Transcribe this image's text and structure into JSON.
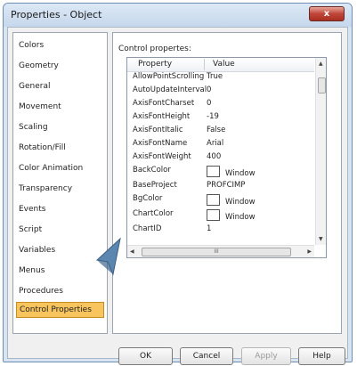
{
  "window": {
    "title": "Properties - Object",
    "close_glyph": "x"
  },
  "sidebar": {
    "items": [
      {
        "label": "Colors"
      },
      {
        "label": "Geometry"
      },
      {
        "label": "General"
      },
      {
        "label": "Movement"
      },
      {
        "label": "Scaling"
      },
      {
        "label": "Rotation/Fill"
      },
      {
        "label": "Color Animation"
      },
      {
        "label": "Transparency"
      },
      {
        "label": "Events"
      },
      {
        "label": "Script"
      },
      {
        "label": "Variables"
      },
      {
        "label": "Menus"
      },
      {
        "label": "Procedures"
      },
      {
        "label": "Control Properties",
        "selected": true
      }
    ]
  },
  "main": {
    "section_label": "Control propertes:",
    "columns": {
      "property": "Property",
      "value": "Value"
    },
    "rows": [
      {
        "property": "AllowPointScrolling",
        "value": "True"
      },
      {
        "property": "AutoUpdateInterval",
        "value": "0"
      },
      {
        "property": "AxisFontCharset",
        "value": "0"
      },
      {
        "property": "AxisFontHeight",
        "value": "-19"
      },
      {
        "property": "AxisFontItalic",
        "value": "False"
      },
      {
        "property": "AxisFontName",
        "value": "Arial"
      },
      {
        "property": "AxisFontWeight",
        "value": "400"
      },
      {
        "property": "BackColor",
        "value": "Window",
        "swatch": "#ffffff"
      },
      {
        "property": "BaseProject",
        "value": "PROFCIMP"
      },
      {
        "property": "BgColor",
        "value": "Window",
        "swatch": "#ffffff"
      },
      {
        "property": "ChartColor",
        "value": "Window",
        "swatch": "#ffffff"
      },
      {
        "property": "ChartID",
        "value": "1"
      }
    ],
    "hscroll_grip": "III"
  },
  "buttons": {
    "ok": "OK",
    "cancel": "Cancel",
    "apply": "Apply",
    "help": "Help"
  },
  "colors": {
    "selected_item_bg": "#f8c45e",
    "title_bar": "#c6d8ec",
    "close_button": "#c0453a",
    "cursor_arrow": "#5b86b0"
  },
  "icons": {
    "close": "close-icon",
    "cursor": "cursor-arrow-icon"
  }
}
